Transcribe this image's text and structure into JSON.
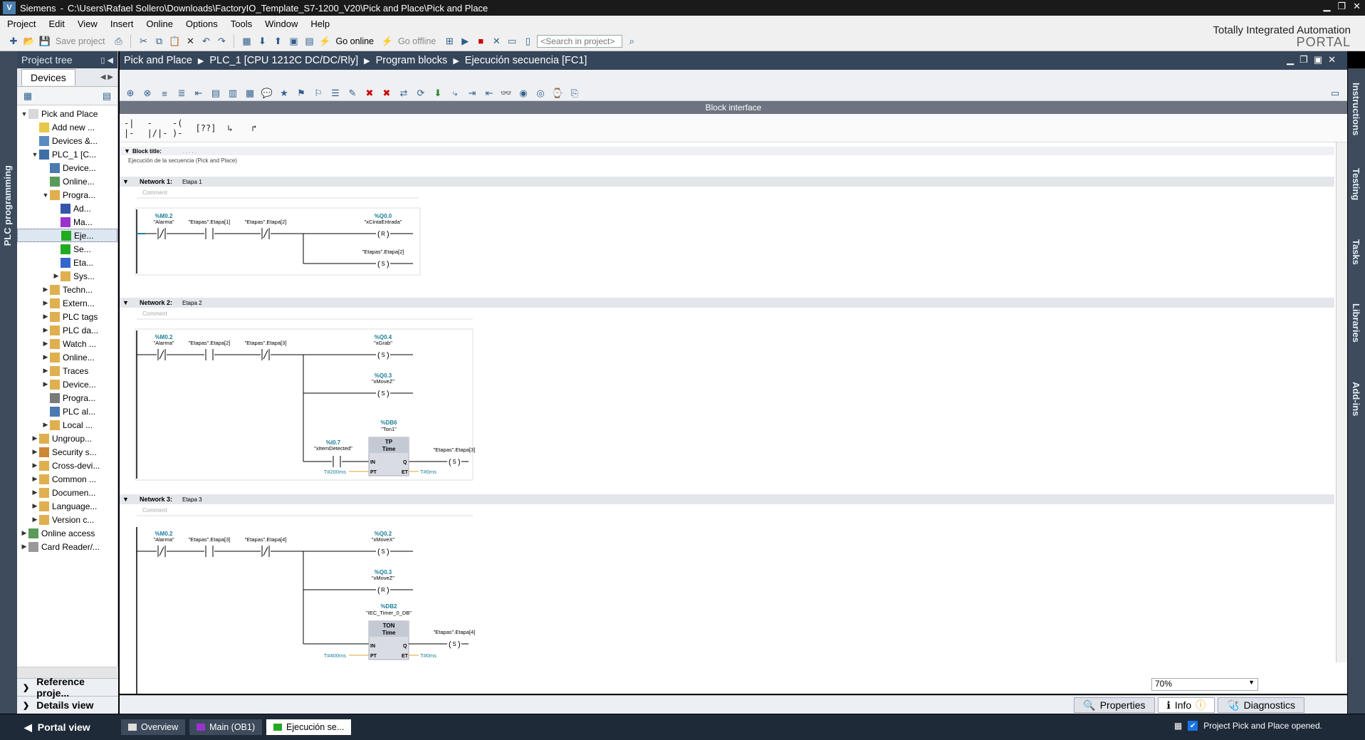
{
  "window": {
    "app": "Siemens",
    "path": "C:\\Users\\Rafael Sollero\\Downloads\\FactoryIO_Template_S7-1200_V20\\Pick and Place\\Pick and Place",
    "title_sep": "-"
  },
  "menu": [
    "Project",
    "Edit",
    "View",
    "Insert",
    "Online",
    "Options",
    "Tools",
    "Window",
    "Help"
  ],
  "toolbar": {
    "save_project": "Save project",
    "go_online": "Go online",
    "go_offline": "Go offline",
    "search_placeholder": "<Search in project>"
  },
  "brand": {
    "line1": "Totally Integrated Automation",
    "line2": "PORTAL"
  },
  "left_strip": "PLC programming",
  "project_tree": {
    "header": "Project tree",
    "tab": "Devices",
    "items": [
      {
        "indent": 0,
        "arrow": "▼",
        "icon": "project-icon",
        "color": "#d8d8d8",
        "label": "Pick and Place"
      },
      {
        "indent": 1,
        "arrow": "",
        "icon": "add-icon",
        "color": "#e8c84a",
        "label": "Add new ..."
      },
      {
        "indent": 1,
        "arrow": "",
        "icon": "devices-icon",
        "color": "#5a8cc0",
        "label": "Devices &..."
      },
      {
        "indent": 1,
        "arrow": "▼",
        "icon": "plc-icon",
        "color": "#3f6fa8",
        "label": "PLC_1 [C..."
      },
      {
        "indent": 2,
        "arrow": "",
        "icon": "device-config-icon",
        "color": "#4a7ab0",
        "label": "Device..."
      },
      {
        "indent": 2,
        "arrow": "",
        "icon": "online-icon",
        "color": "#5a9a5a",
        "label": "Online..."
      },
      {
        "indent": 2,
        "arrow": "▼",
        "icon": "folder-icon",
        "color": "#e0b050",
        "label": "Progra..."
      },
      {
        "indent": 3,
        "arrow": "",
        "icon": "add-block-icon",
        "color": "#3355aa",
        "label": "Ad..."
      },
      {
        "indent": 3,
        "arrow": "",
        "icon": "ob-icon",
        "color": "#9933cc",
        "label": "Ma..."
      },
      {
        "indent": 3,
        "arrow": "",
        "icon": "fc-icon",
        "color": "#22aa22",
        "label": "Eje...",
        "selected": true
      },
      {
        "indent": 3,
        "arrow": "",
        "icon": "fc-icon",
        "color": "#22aa22",
        "label": "Se..."
      },
      {
        "indent": 3,
        "arrow": "",
        "icon": "db-icon",
        "color": "#3366cc",
        "label": "Eta..."
      },
      {
        "indent": 3,
        "arrow": "▶",
        "icon": "folder-icon",
        "color": "#e0b050",
        "label": "Sys..."
      },
      {
        "indent": 2,
        "arrow": "▶",
        "icon": "folder-icon",
        "color": "#e0b050",
        "label": "Techn..."
      },
      {
        "indent": 2,
        "arrow": "▶",
        "icon": "folder-icon",
        "color": "#e0b050",
        "label": "Extern..."
      },
      {
        "indent": 2,
        "arrow": "▶",
        "icon": "folder-icon",
        "color": "#e0b050",
        "label": "PLC tags"
      },
      {
        "indent": 2,
        "arrow": "▶",
        "icon": "folder-icon",
        "color": "#e0b050",
        "label": "PLC da..."
      },
      {
        "indent": 2,
        "arrow": "▶",
        "icon": "folder-icon",
        "color": "#e0b050",
        "label": "Watch ..."
      },
      {
        "indent": 2,
        "arrow": "▶",
        "icon": "folder-icon",
        "color": "#e0b050",
        "label": "Online..."
      },
      {
        "indent": 2,
        "arrow": "▶",
        "icon": "folder-icon",
        "color": "#e0b050",
        "label": "Traces"
      },
      {
        "indent": 2,
        "arrow": "▶",
        "icon": "folder-icon",
        "color": "#e0b050",
        "label": "Device..."
      },
      {
        "indent": 2,
        "arrow": "",
        "icon": "program-info-icon",
        "color": "#7a7a7a",
        "label": "Progra..."
      },
      {
        "indent": 2,
        "arrow": "",
        "icon": "alarm-icon",
        "color": "#4a7ab0",
        "label": "PLC al..."
      },
      {
        "indent": 2,
        "arrow": "▶",
        "icon": "folder-icon",
        "color": "#e0b050",
        "label": "Local ..."
      },
      {
        "indent": 1,
        "arrow": "▶",
        "icon": "folder-icon",
        "color": "#e0b050",
        "label": "Ungroup..."
      },
      {
        "indent": 1,
        "arrow": "▶",
        "icon": "security-icon",
        "color": "#cc8833",
        "label": "Security s..."
      },
      {
        "indent": 1,
        "arrow": "▶",
        "icon": "folder-icon",
        "color": "#e0b050",
        "label": "Cross-devi..."
      },
      {
        "indent": 1,
        "arrow": "▶",
        "icon": "folder-icon",
        "color": "#e0b050",
        "label": "Common ..."
      },
      {
        "indent": 1,
        "arrow": "▶",
        "icon": "folder-icon",
        "color": "#e0b050",
        "label": "Documen..."
      },
      {
        "indent": 1,
        "arrow": "▶",
        "icon": "folder-icon",
        "color": "#e0b050",
        "label": "Language..."
      },
      {
        "indent": 1,
        "arrow": "▶",
        "icon": "folder-icon",
        "color": "#e0b050",
        "label": "Version c..."
      },
      {
        "indent": 0,
        "arrow": "▶",
        "icon": "online-access-icon",
        "color": "#5a9a5a",
        "label": "Online access"
      },
      {
        "indent": 0,
        "arrow": "▶",
        "icon": "card-reader-icon",
        "color": "#999999",
        "label": "Card Reader/..."
      }
    ],
    "reference": "Reference proje...",
    "details": "Details view"
  },
  "breadcrumb": [
    "Pick and Place",
    "PLC_1 [CPU 1212C DC/DC/Rly]",
    "Program blocks",
    "Ejecución secuencia [FC1]"
  ],
  "block_interface": "Block interface",
  "block_title_label": "Block title:",
  "block_title_dots": ". . . . .",
  "block_comment": "Ejecución de la secuencia (Pick and Place)",
  "networks": [
    {
      "label": "Network 1:",
      "title": "Etapa 1",
      "comment": "Comment"
    },
    {
      "label": "Network 2:",
      "title": "Etapa 2",
      "comment": "Comment"
    },
    {
      "label": "Network 3:",
      "title": "Etapa 3",
      "comment": "Comment"
    }
  ],
  "ladder": {
    "n1": {
      "c1_addr": "%M0.2",
      "c1_name": "\"Alarma\"",
      "c2_name": "\"Etapas\".Etapa[1]",
      "c3_name": "\"Etapas\".Etapa[2]",
      "o1_addr": "%Q0.0",
      "o1_name": "\"xCintaEntrada\"",
      "o1_type": "R",
      "o2_name": "\"Etapas\".Etapa[2]",
      "o2_type": "S"
    },
    "n2": {
      "c1_addr": "%M0.2",
      "c1_name": "\"Alarma\"",
      "c2_name": "\"Etapas\".Etapa[2]",
      "c3_name": "\"Etapas\".Etapa[3]",
      "o1_addr": "%Q0.4",
      "o1_name": "\"xGrab\"",
      "o1_type": "S",
      "o2_addr": "%Q0.3",
      "o2_name": "\"xMoveZ\"",
      "o2_type": "S",
      "t_db": "%DB6",
      "t_name": "\"Ton1\"",
      "t_type": "TP",
      "t_sub": "Time",
      "in_addr": "%I0.7",
      "in_name": "\"xItemDetected\"",
      "pt": "T#200ms",
      "et": "T#0ms",
      "q_name": "\"Etapas\".Etapa[3]",
      "q_type": "S"
    },
    "n3": {
      "c1_addr": "%M0.2",
      "c1_name": "\"Alarma\"",
      "c2_name": "\"Etapas\".Etapa[3]",
      "c3_name": "\"Etapas\".Etapa[4]",
      "o1_addr": "%Q0.2",
      "o1_name": "\"xMoveX\"",
      "o1_type": "S",
      "o2_addr": "%Q0.3",
      "o2_name": "\"xMoveZ\"",
      "o2_type": "R",
      "t_db": "%DB2",
      "t_name": "\"IEC_Timer_0_DB\"",
      "t_type": "TON",
      "t_sub": "Time",
      "pt": "T#400ms",
      "et": "T#0ms",
      "q_name": "\"Etapas\".Etapa[4]",
      "q_type": "S"
    },
    "pin_in": "IN",
    "pin_pt": "PT",
    "pin_q": "Q",
    "pin_et": "ET"
  },
  "zoom": "70%",
  "right_tabs": [
    "Instructions",
    "Testing",
    "Tasks",
    "Libraries",
    "Add-ins"
  ],
  "info_tabs": {
    "properties": "Properties",
    "info": "Info",
    "diagnostics": "Diagnostics"
  },
  "status": {
    "portal_view": "Portal view",
    "tabs": [
      {
        "label": "Overview",
        "icon": "overview-icon",
        "color": "#dddddd"
      },
      {
        "label": "Main (OB1)",
        "icon": "ob-icon",
        "color": "#9933cc"
      },
      {
        "label": "Ejecución se...",
        "icon": "fc-icon",
        "color": "#22aa22"
      }
    ],
    "message": "Project Pick and Place opened."
  },
  "colors": {
    "address": "#1a7f9a",
    "accent": "#36465a"
  }
}
